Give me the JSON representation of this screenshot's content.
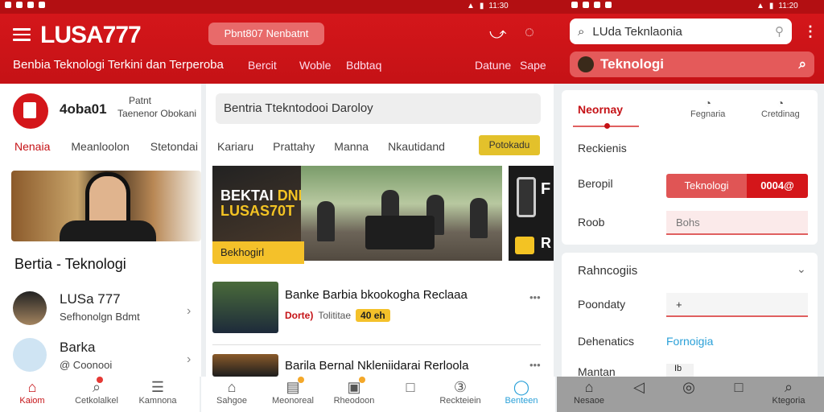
{
  "status_bar": {
    "time_left": "11:30",
    "time_right": "11:20"
  },
  "header": {
    "logo": "LUSA777",
    "pill": "Pbnt807 Nenbatnt",
    "tagline": "Benbia Teknologi Terkini dan Terperoba",
    "nav": [
      "Bercit",
      "Woble",
      "Bdbtaq",
      "Datune",
      "Sape"
    ]
  },
  "top_search": {
    "value": "LUda Teknlaonia",
    "highlight": "Teknologi"
  },
  "col1": {
    "profile": {
      "name": "4oba01",
      "line1": "Patnt",
      "line2": "Taenenor Obokani"
    },
    "tabs": [
      "Nenaia",
      "Meanloolon",
      "Stetondai"
    ],
    "section_title": "Bertia - Teknologi",
    "items": [
      {
        "title": "LUSa 777",
        "subtitle": "Sefhonolgn  Bdmt"
      },
      {
        "title": "Barka",
        "subtitle": "@ Coonooi"
      }
    ]
  },
  "col2": {
    "search_value": "Bentria Ttekntodooi Daroloy",
    "tabs": [
      "Kariaru",
      "Prattahy",
      "Manna",
      "Nkautidand"
    ],
    "tab_button": "Potokadu",
    "hero": {
      "line1": "BEKTAI",
      "line1b": "DNI",
      "line2": "LUSAS70T",
      "label": "Bekhogirl"
    },
    "hero_side": {
      "letter": "F",
      "letter2": "R"
    },
    "articles": [
      {
        "title": "Banke Barbia bkookogha Reclaaa",
        "category": "Dorte)",
        "meta": "Tolititae",
        "badge": "40 eh"
      },
      {
        "title": "Barila Bernal Nkleniidarai Rerloola",
        "category": "",
        "meta": "",
        "badge": ""
      }
    ],
    "more": "•••"
  },
  "col3": {
    "tabs": [
      "Neornay",
      "Fegnaria",
      "Cretdinag"
    ],
    "labels": [
      "Reckienis",
      "Beropil",
      "Roob"
    ],
    "btn_red": "Teknologi",
    "btn_red2": "0004@",
    "input_placeholder": "Bohs",
    "card2": {
      "title": "Rahncogiis",
      "labels": [
        "Poondaty",
        "Dehenatics",
        "Mantan"
      ],
      "input_value": "+",
      "link": "Fornoigia",
      "small": "Ib"
    }
  },
  "bottom_nav1": [
    "Kaiom",
    "Cetkolalkel",
    "Kamnona"
  ],
  "bottom_nav2": [
    "Sahgoe",
    "Meonoreal",
    "Rheodoon",
    "",
    "Reckteiein",
    "Benteen"
  ],
  "bottom_nav3": [
    "Nesaoe",
    "",
    "",
    "",
    "Ktegoria"
  ],
  "colors": {
    "brand": "#c51216",
    "accent": "#f4c12a",
    "link": "#2aa0d8"
  }
}
